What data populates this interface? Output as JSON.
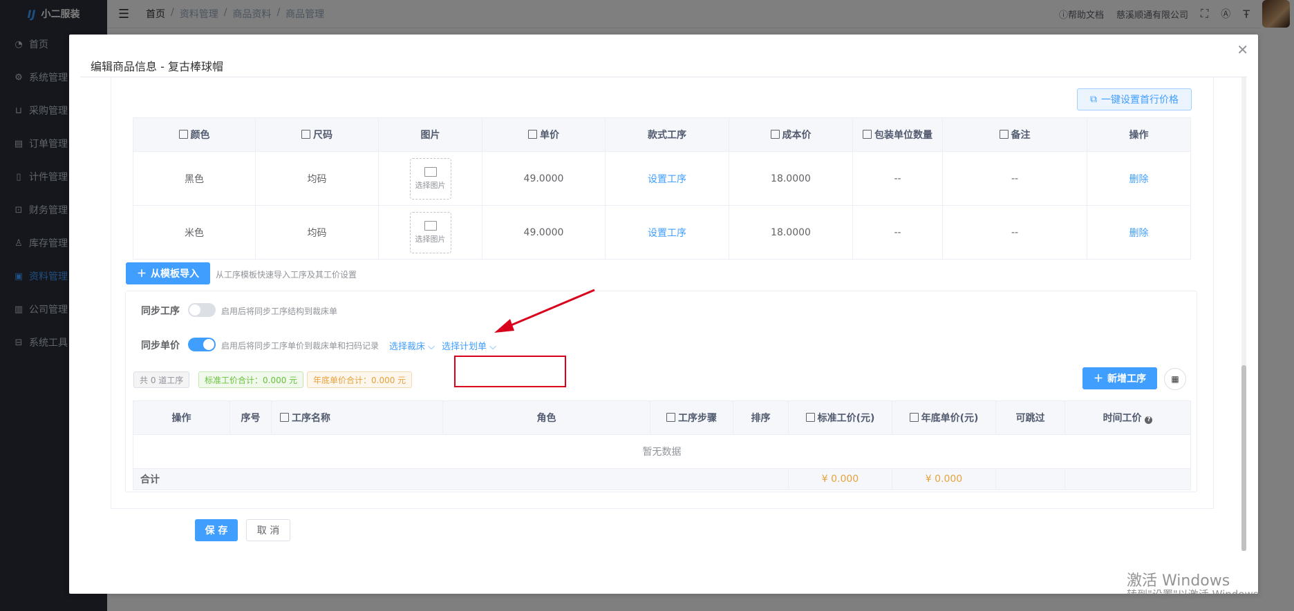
{
  "app": {
    "name": "小二服装",
    "logo_text": "IJ"
  },
  "sidebar": {
    "items": [
      {
        "label": "首页",
        "icon": "dashboard-icon"
      },
      {
        "label": "系统管理",
        "icon": "gear-icon"
      },
      {
        "label": "采购管理",
        "icon": "cart-icon"
      },
      {
        "label": "订单管理",
        "icon": "order-icon"
      },
      {
        "label": "计件管理",
        "icon": "book-icon"
      },
      {
        "label": "财务管理",
        "icon": "chart-icon"
      },
      {
        "label": "库存管理",
        "icon": "user-icon"
      },
      {
        "label": "资料管理",
        "icon": "doc-icon",
        "active": true
      },
      {
        "label": "公司管理",
        "icon": "bar-chart-icon"
      },
      {
        "label": "系统工具",
        "icon": "toolbox-icon"
      }
    ]
  },
  "header": {
    "breadcrumb": [
      "首页",
      "资料管理",
      "商品资料",
      "商品管理"
    ],
    "help_label": "帮助文档",
    "company": "慈溪顺通有限公司"
  },
  "dialog": {
    "title": "编辑商品信息 - 复古棒球帽",
    "set_price_button": "一键设置首行价格",
    "product_table": {
      "headers": [
        "颜色",
        "尺码",
        "图片",
        "单价",
        "款式工序",
        "成本价",
        "包装单位数量",
        "备注",
        "操作"
      ],
      "rows": [
        {
          "color": "黑色",
          "size": "均码",
          "image": "选择图片",
          "price": "49.0000",
          "process": "设置工序",
          "cost": "18.0000",
          "pack": "--",
          "note": "--",
          "action": "删除"
        },
        {
          "color": "米色",
          "size": "均码",
          "image": "选择图片",
          "price": "49.0000",
          "process": "设置工序",
          "cost": "18.0000",
          "pack": "--",
          "note": "--",
          "action": "删除"
        }
      ]
    },
    "import_button": "从模板导入",
    "import_hint": "从工序模板快速导入工序及其工价设置",
    "sync_process": {
      "label": "同步工序",
      "hint": "启用后将同步工序结构到裁床单",
      "enabled": false
    },
    "sync_price": {
      "label": "同步单价",
      "hint": "启用后将同步工序单价到裁床单和扫码记录",
      "enabled": true,
      "select_bed": "选择裁床",
      "select_plan": "选择计划单"
    },
    "tags": {
      "count": "共 0 道工序",
      "standard_total": "标准工价合计：0.000 元",
      "yearend_total": "年底单价合计：0.000 元"
    },
    "add_process_button": "新增工序",
    "process_table": {
      "headers": [
        "操作",
        "序号",
        "工序名称",
        "角色",
        "工序步骤",
        "排序",
        "标准工价(元)",
        "年底单价(元)",
        "可跳过",
        "时间工价"
      ],
      "empty_text": "暂无数据",
      "sum_label": "合计",
      "sum_standard": "¥ 0.000",
      "sum_yearend": "¥ 0.000"
    },
    "save_button": "保 存",
    "cancel_button": "取 消"
  },
  "watermark": {
    "line1": "激活 Windows",
    "line2": "转到\"设置\"以激活 Windows。"
  },
  "colors": {
    "primary": "#409eff",
    "sidebar": "#2b2f3a",
    "danger": "#d9001b",
    "success": "#67c23a",
    "warning": "#e6a23c"
  }
}
